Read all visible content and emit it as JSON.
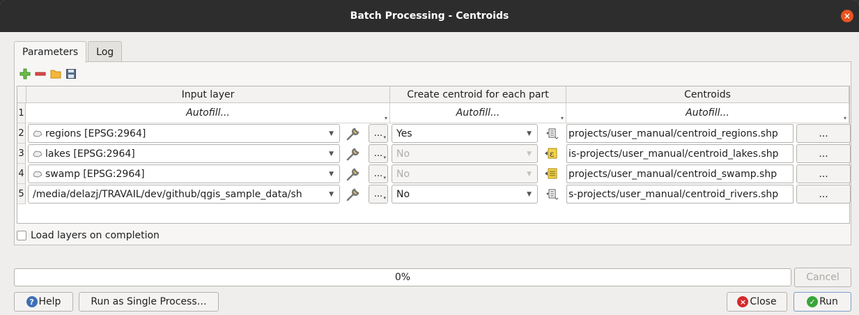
{
  "window": {
    "title": "Batch Processing - Centroids",
    "close_glyph": "×"
  },
  "tabs": [
    {
      "label": "Parameters",
      "active": true
    },
    {
      "label": "Log",
      "active": false
    }
  ],
  "toolbar": {
    "icons": [
      "add-row-icon",
      "remove-row-icon",
      "open-folder-icon",
      "save-icon"
    ]
  },
  "grid": {
    "headers": [
      "Input layer",
      "Create centroid for each part",
      "Centroids"
    ],
    "autofill_row": {
      "num": "1",
      "label": "Autofill..."
    },
    "rows": [
      {
        "num": "2",
        "input": "regions [EPSG:2964]",
        "input_icon": "polygon-layer-icon",
        "part": "Yes",
        "part_disabled": false,
        "output": "projects/user_manual/centroid_regions.shp"
      },
      {
        "num": "3",
        "input": "lakes [EPSG:2964]",
        "input_icon": "polygon-layer-icon",
        "part": "No",
        "part_disabled": true,
        "output": "is-projects/user_manual/centroid_lakes.shp"
      },
      {
        "num": "4",
        "input": "swamp [EPSG:2964]",
        "input_icon": "polygon-layer-icon",
        "part": "No",
        "part_disabled": true,
        "output": "projects/user_manual/centroid_swamp.shp"
      },
      {
        "num": "5",
        "input": "/media/delazj/TRAVAIL/dev/github/qgis_sample_data/sh",
        "input_icon": "",
        "part": "No",
        "part_disabled": false,
        "output": "s-projects/user_manual/centroid_rivers.shp"
      }
    ],
    "ellipsis": "...",
    "browse": "..."
  },
  "load_layers_label": "Load layers on completion",
  "progress": {
    "text": "0%",
    "value": 0
  },
  "buttons": {
    "cancel": "Cancel",
    "help": "Help",
    "single": "Run as Single Process…",
    "close": "Close",
    "run": "Run"
  },
  "colors": {
    "titlebar": "#2d2d2d",
    "close": "#e95420",
    "help": "#3d6fb6",
    "run": "#3aa53a"
  }
}
